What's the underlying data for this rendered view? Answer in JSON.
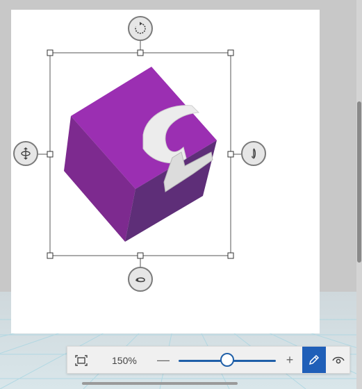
{
  "toolbar": {
    "zoom_label": "150%",
    "zoom_level_percent": 150,
    "zoom_slider_fraction": 0.5,
    "minus_glyph": "—",
    "plus_glyph": "+"
  },
  "icons": {
    "fit": "fit-to-window-icon",
    "edit": "pen-edit-icon",
    "view": "eye-view-icon",
    "rotate_top": "rotate-z-icon",
    "rotate_left": "tilt-x-icon",
    "rotate_right": "spin-y-icon",
    "rotate_bottom": "rotate-x-icon"
  },
  "colors": {
    "accent": "#1f5fb8",
    "cube_top": "#9b2fb2",
    "cube_left": "#7d2a8f",
    "cube_right": "#5e2e78",
    "canvas": "#ffffff"
  }
}
